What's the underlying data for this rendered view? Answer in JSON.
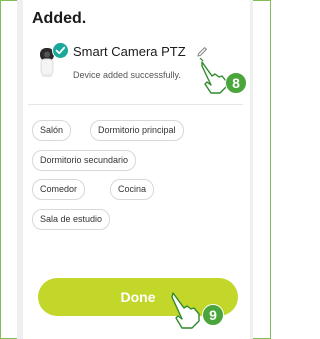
{
  "header": {
    "title": "Added."
  },
  "device": {
    "name": "Smart Camera PTZ",
    "status": "Device added successfully."
  },
  "rooms": [
    "Salón",
    "Dormitorio principal",
    "Dormitorio secundario",
    "Comedor",
    "Cocina",
    "Sala de estudio"
  ],
  "actions": {
    "done_label": "Done"
  },
  "steps": {
    "edit_step": "8",
    "done_step": "9"
  },
  "icons": {
    "device": "camera-icon",
    "badge": "check-icon",
    "edit": "pencil-icon",
    "pointer": "hand-pointer-icon"
  },
  "colors": {
    "accent": "#c3d62a",
    "badge": "#1aa89a",
    "step_marker": "#4aa63a",
    "frame_border": "#7fbf55"
  }
}
